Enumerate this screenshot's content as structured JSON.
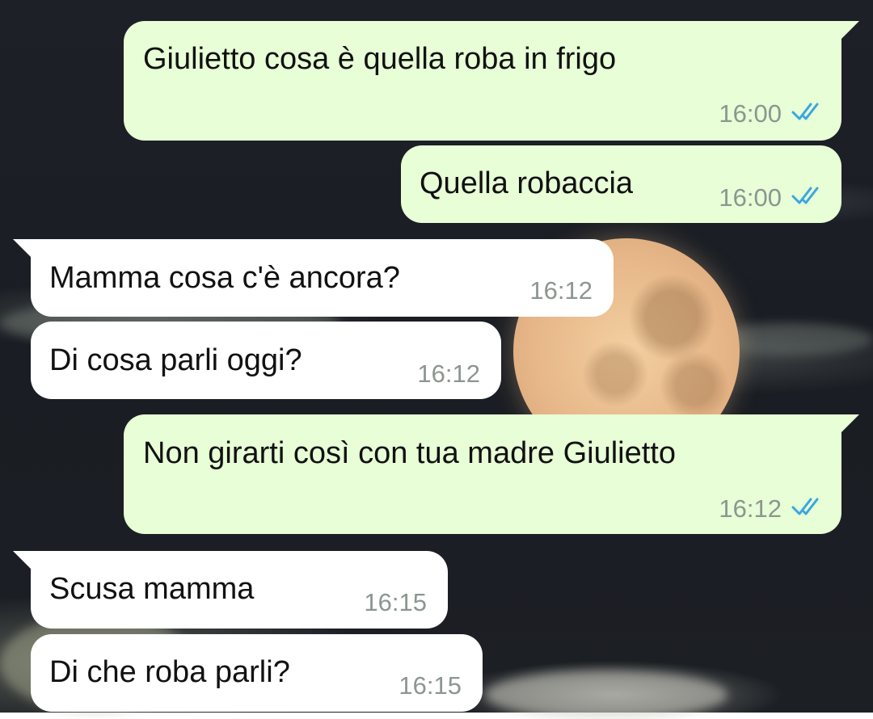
{
  "theme": {
    "outgoing_bubble": "#e7fed6",
    "incoming_bubble": "#ffffff",
    "read_tick": "#3aa6e0"
  },
  "wallpaper": {
    "icon": "moon-night-wallpaper"
  },
  "messages": [
    {
      "direction": "outgoing",
      "text": "Giulietto cosa è quella roba in frigo",
      "time": "16:00",
      "status": "read"
    },
    {
      "direction": "outgoing",
      "text": "Quella robaccia",
      "time": "16:00",
      "status": "read"
    },
    {
      "direction": "incoming",
      "text": "Mamma cosa c'è ancora?",
      "time": "16:12"
    },
    {
      "direction": "incoming",
      "text": "Di cosa parli oggi?",
      "time": "16:12"
    },
    {
      "direction": "outgoing",
      "text": "Non girarti così con tua madre Giulietto",
      "time": "16:12",
      "status": "read"
    },
    {
      "direction": "incoming",
      "text": "Scusa mamma",
      "time": "16:15"
    },
    {
      "direction": "incoming",
      "text": "Di che roba parli?",
      "time": "16:15"
    }
  ]
}
